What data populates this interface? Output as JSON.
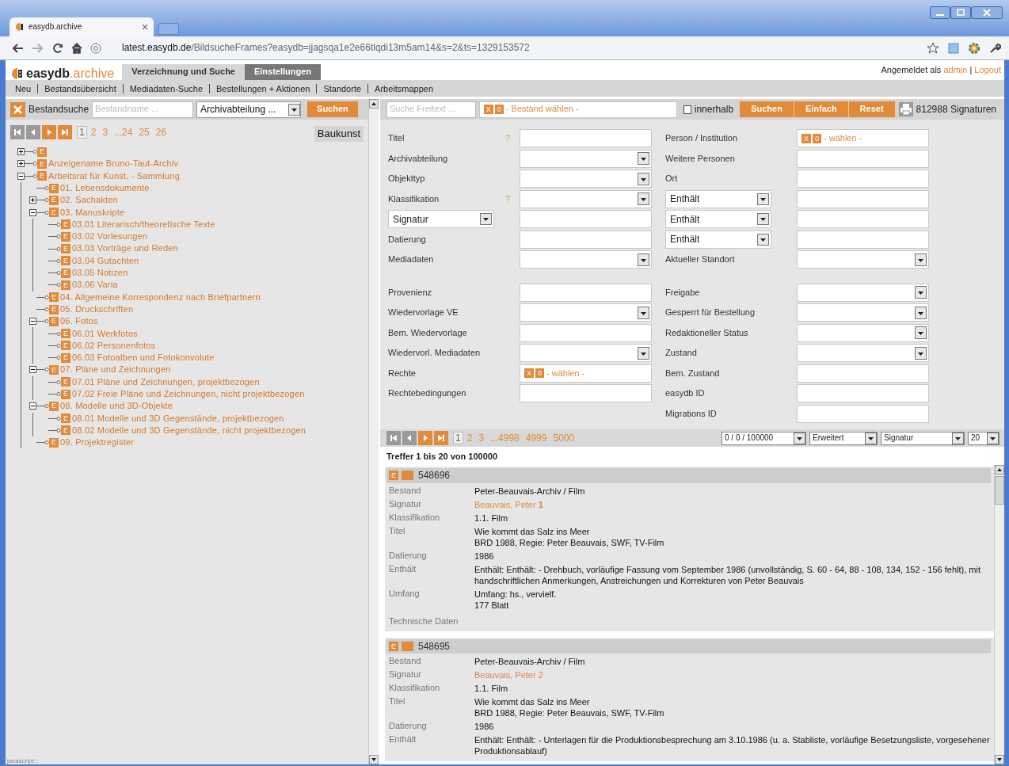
{
  "browser": {
    "tab_title": "easydb.archive",
    "url_host": "latest.easydb.de",
    "url_path": "/BildsucheFrames?easydb=jjagsqa1e2e66tlqdi13m5am14&s=2&ts=1329153572"
  },
  "app": {
    "logo_name": "easydb",
    "logo_suffix": ".archive",
    "tabs": [
      {
        "label": "Verzeichnung und Suche",
        "selected": true
      },
      {
        "label": "Einstellungen",
        "selected": false
      }
    ],
    "user_prefix": "Angemeldet als",
    "user_name": "admin",
    "user_separator": "|",
    "logout": "Logout"
  },
  "menu": [
    "Neu",
    "Bestandsübersicht",
    "Mediadaten-Suche",
    "Bestellungen + Aktionen",
    "Standorte",
    "Arbeitsmappen"
  ],
  "left_panel": {
    "search": {
      "label": "Bestandsuche",
      "placeholder": "Bestandname ...",
      "select": "Archivabteilung ...",
      "button": "Suchen"
    },
    "pager": {
      "nav": [
        {
          "kind": "first",
          "disabled": true
        },
        {
          "kind": "prev",
          "disabled": true
        },
        {
          "kind": "next",
          "disabled": false
        },
        {
          "kind": "last",
          "disabled": false
        }
      ],
      "pages": [
        {
          "label": "1",
          "selected": true
        },
        {
          "label": "2",
          "selected": false
        },
        {
          "label": "3",
          "selected": false
        },
        {
          "label": "...24",
          "selected": false
        },
        {
          "label": "25",
          "selected": false
        },
        {
          "label": "26",
          "selected": false
        }
      ]
    },
    "header": "Baukunst",
    "tree": [
      {
        "badge": "E",
        "expanded": false
      },
      {
        "badge": "E",
        "label": "Anzeigename Bruno-Taut-Archiv",
        "expanded": false
      },
      {
        "badge": "E",
        "label": "Arbeitsrat für Kunst, - Sammlung",
        "expanded": true,
        "children": [
          {
            "badge": "E",
            "label": "01. Lebensdokumente"
          },
          {
            "badge": "E",
            "label": "02. Sachakten",
            "expanded": false
          },
          {
            "badge": "E",
            "label": "03. Manuskripte",
            "expanded": true,
            "children": [
              {
                "badge": "E",
                "label": "03.01 Literarisch/theoretische Texte"
              },
              {
                "badge": "E",
                "label": "03.02 Vorlesungen"
              },
              {
                "badge": "E",
                "label": "03.03 Vorträge und Reden"
              },
              {
                "badge": "E",
                "label": "03.04 Gutachten"
              },
              {
                "badge": "E",
                "label": "03.05 Notizen"
              },
              {
                "badge": "E",
                "label": "03.06 Varia"
              }
            ]
          },
          {
            "badge": "E",
            "label": "04. Allgemeine Korrespondenz nach Briefpartnern"
          },
          {
            "badge": "E",
            "label": "05. Druckschriften"
          },
          {
            "badge": "E",
            "label": "06. Fotos",
            "expanded": true,
            "children": [
              {
                "badge": "E",
                "label": "06.01 Werkfotos"
              },
              {
                "badge": "E",
                "label": "06.02 Personenfotos"
              },
              {
                "badge": "E",
                "label": "06.03 Fotoalben und Fotokonvolute"
              }
            ]
          },
          {
            "badge": "E",
            "label": "07. Pläne und Zeichnungen",
            "expanded": true,
            "children": [
              {
                "badge": "E",
                "label": "07.01 Pläne und Zeichnungen, projektbezogen"
              },
              {
                "badge": "E",
                "label": "07.02 Freie Pläne und Zeichnungen, nicht projektbezogen"
              }
            ]
          },
          {
            "badge": "E",
            "label": "08. Modelle und 3D-Objekte",
            "expanded": true,
            "children": [
              {
                "badge": "E",
                "label": "08.01 Modelle und 3D Gegenstände, projektbezogen"
              },
              {
                "badge": "E",
                "label": "08.02 Modelle und 3D Gegenstände, nicht projektbezogen"
              }
            ]
          },
          {
            "badge": "E",
            "label": "09. Projektregister"
          }
        ]
      }
    ]
  },
  "right_panel": {
    "toolbar": {
      "placeholder": "Suche Freitext ...",
      "chooser": {
        "clear": "X",
        "count": "0",
        "text": "- Bestand wählen -"
      },
      "within": {
        "label": "innerhalb",
        "checked": false
      },
      "buttons": [
        "Suchen",
        "Einfach",
        "Reset"
      ],
      "count": "812988 Signaturen"
    },
    "form": {
      "left": [
        [
          {
            "label": "Titel",
            "help": "?",
            "kind": "text"
          },
          {
            "label": "Archivabteilung",
            "kind": "select"
          },
          {
            "label": "Objekttyp",
            "kind": "select"
          },
          {
            "label": "Klassifikation",
            "help": "?",
            "kind": "select"
          },
          {
            "label": "Signatur",
            "kind": "operator"
          },
          {
            "label": "Datierung",
            "kind": "text"
          },
          {
            "label": "Mediadaten",
            "kind": "select"
          }
        ],
        [
          {
            "label": "Provenienz",
            "kind": "text"
          },
          {
            "label": "Wiedervorlage VE",
            "kind": "select"
          },
          {
            "label": "Bem. Wiedervorlage",
            "kind": "text"
          },
          {
            "label": "Wiedervorl. Mediadaten",
            "kind": "select"
          },
          {
            "label": "Rechte",
            "kind": "chooser",
            "chooser": {
              "clear": "X",
              "count": "0",
              "text": "- wählen -"
            }
          },
          {
            "label": "Rechtebedingungen",
            "kind": "text"
          }
        ]
      ],
      "right": [
        [
          {
            "label": "Person / Institution",
            "kind": "chooser",
            "chooser": {
              "clear": "X",
              "count": "0",
              "text": "- wählen -"
            }
          },
          {
            "label": "Weitere Personen",
            "kind": "text"
          },
          {
            "label": "Ort",
            "kind": "text"
          },
          {
            "label": "Enthält",
            "kind": "operator"
          },
          {
            "label": "Enthält",
            "kind": "operator"
          },
          {
            "label": "Enthält",
            "kind": "operator"
          },
          {
            "label": "Aktueller Standort",
            "kind": "select"
          }
        ],
        [
          {
            "label": "Freigabe",
            "kind": "select"
          },
          {
            "label": "Gesperrt für Bestellung",
            "kind": "select"
          },
          {
            "label": "Redaktioneller Status",
            "kind": "select"
          },
          {
            "label": "Zustand",
            "kind": "select"
          },
          {
            "label": "Bem. Zustand",
            "kind": "text"
          },
          {
            "label": "easydb ID",
            "kind": "text"
          },
          {
            "label": "Migrations ID",
            "kind": "text"
          }
        ]
      ]
    },
    "results": {
      "pager": {
        "nav": [
          {
            "kind": "first",
            "disabled": true
          },
          {
            "kind": "prev",
            "disabled": true
          },
          {
            "kind": "next",
            "disabled": false
          },
          {
            "kind": "last",
            "disabled": false
          }
        ],
        "pages": [
          {
            "label": "1",
            "selected": true
          },
          {
            "label": "2",
            "selected": false
          },
          {
            "label": "3",
            "selected": false
          },
          {
            "label": "...4998",
            "selected": false
          },
          {
            "label": "4999",
            "selected": false
          },
          {
            "label": "5000",
            "selected": false
          }
        ],
        "selects": [
          "0 / 0 / 100000",
          "Erweitert",
          "Signatur",
          "20"
        ]
      },
      "summary": "Treffer 1 bis 20 von 100000",
      "records": [
        {
          "badge": "E",
          "id": "548696",
          "fields": [
            {
              "label": "Bestand",
              "kind": "text",
              "lines": [
                "Peter-Beauvais-Archiv / Film"
              ]
            },
            {
              "label": "Signatur",
              "kind": "link",
              "lines": [
                "Beauvais, Peter **1**"
              ]
            },
            {
              "label": "Klassifikation",
              "kind": "text",
              "lines": [
                "1.1. Film"
              ]
            },
            {
              "label": "Titel",
              "kind": "text",
              "lines": [
                "Wie kommt das Salz ins Meer",
                "BRD 1988, Regie: Peter Beauvais, SWF, TV-Film"
              ]
            },
            {
              "label": "Datierung",
              "kind": "text",
              "lines": [
                "1986"
              ]
            },
            {
              "label": "Enthält",
              "kind": "text",
              "lines": [
                "Enthält: Enthält: - Drehbuch, vorläufige Fassung vom September 1986 (unvollständig, S. 60 - 64, 88 - 108, 134, 152 - 156 fehlt), mit handschriftlichen Anmerkungen, Anstreichungen und Korrekturen von Peter Beauvais"
              ]
            },
            {
              "label": "Umfang",
              "kind": "text",
              "lines": [
                "Umfang: hs., vervielf.",
                "177 Blatt"
              ]
            },
            {
              "label": "Technische Daten",
              "kind": "empty"
            }
          ]
        },
        {
          "badge": "E",
          "id": "548695",
          "fields": [
            {
              "label": "Bestand",
              "kind": "text",
              "lines": [
                "Peter-Beauvais-Archiv / Film"
              ]
            },
            {
              "label": "Signatur",
              "kind": "link",
              "lines": [
                "Beauvais, Peter 2"
              ]
            },
            {
              "label": "Klassifikation",
              "kind": "text",
              "lines": [
                "1.1. Film"
              ]
            },
            {
              "label": "Titel",
              "kind": "text",
              "lines": [
                "Wie kommt das Salz ins Meer",
                "BRD 1988, Regie: Peter Beauvais, SWF, TV-Film"
              ]
            },
            {
              "label": "Datierung",
              "kind": "text",
              "lines": [
                "1986"
              ]
            },
            {
              "label": "Enthält",
              "kind": "text",
              "lines": [
                "Enthält: Enthält: - Unterlagen für die Produktionsbesprechung am 3.10.1986 (u. a. Stabliste, vorläufige Besetzungsliste, vorgesehener Produktionsablauf)"
              ]
            }
          ]
        }
      ]
    }
  },
  "status_bar": "javascript:;"
}
